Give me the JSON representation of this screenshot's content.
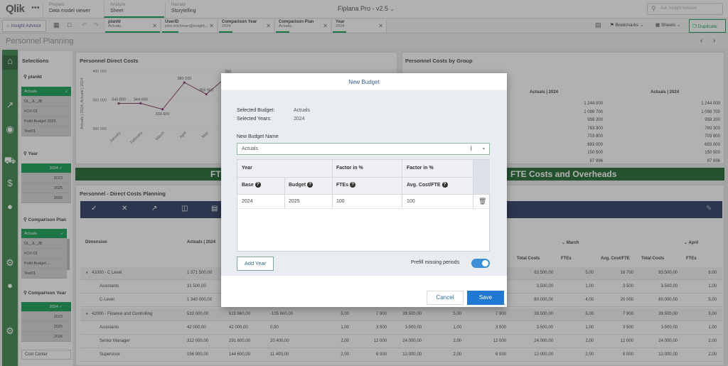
{
  "topbar": {
    "logo": "Qlik",
    "more_icon": "ellipsis-icon",
    "tabs": [
      {
        "sub": "Prepare",
        "main": "Data model viewer"
      },
      {
        "sub": "Analyze",
        "main": "Sheet"
      },
      {
        "sub": "Narrate",
        "main": "Storytelling"
      }
    ],
    "app_title": "Fiplana Pro - v2.5",
    "app_title_chevron": "⌄",
    "search_placeholder": "Ask Insight Advisor"
  },
  "toolbar": {
    "insight_advisor": "Insight Advisor",
    "chips": [
      {
        "name": "planId",
        "value": "Actuals"
      },
      {
        "name": "UserID",
        "value": "john.teichman@insight..."
      },
      {
        "name": "Comparison Year",
        "value": "2024"
      },
      {
        "name": "Comparison Plan",
        "value": "Actuals"
      },
      {
        "name": "Year",
        "value": "2024"
      }
    ],
    "bookmarks": "Bookmarks",
    "sheets": "Sheets",
    "duplicate": "Duplicate"
  },
  "sheet": {
    "title": "Personnel Planning"
  },
  "selections": {
    "title": "Selections",
    "planid": {
      "label": "planId",
      "items": [
        "Actuals",
        "DL_JL_JB",
        "FOV-01",
        "Politi Budget 2025",
        "Test01"
      ]
    },
    "year": {
      "label": "Year",
      "items": [
        "2024",
        "2023",
        "2025",
        "2026"
      ]
    },
    "compplan": {
      "label": "Comparison Plan",
      "items": [
        "Actuals",
        "DL_JL_JB",
        "FOV-01",
        "Politi Budget ...",
        "Test01"
      ]
    },
    "compyear": {
      "label": "Comparison Year",
      "items": [
        "2024",
        "2023",
        "2025",
        "2026"
      ]
    },
    "cost_center": "Cost Center"
  },
  "chart_data": {
    "type": "line",
    "title": "Personnel Direct Costs",
    "ylabel": "Actuals | 2024, Actuals | 2024",
    "ylim": [
      300000,
      400000
    ],
    "yticks": [
      "400 000",
      "350 000",
      "300 000"
    ],
    "categories": [
      "January",
      "February",
      "March",
      "April",
      "May",
      "June"
    ],
    "values": [
      343800,
      344000,
      333600,
      380100,
      359900,
      392000
    ],
    "labels": [
      "343 800",
      "344 000",
      "333 600",
      "380 100",
      "359 900",
      "392"
    ]
  },
  "group_panel": {
    "title": "Personnel Costs by Group",
    "col1": "Actuals | 2024",
    "col2": "Actuals | 2024",
    "values": [
      "1 244 000",
      "1 098 700",
      "959 200",
      "783 300",
      "703 800",
      "693 000",
      "150 500",
      "87 896"
    ]
  },
  "banner": {
    "left": "FT",
    "right": "FTE Costs and Overheads"
  },
  "planning": {
    "title": "Personnel - Direct Costs Planning",
    "dimension": "Dimension",
    "col_actuals": "Actuals | 2024",
    "march": "March",
    "april": "April",
    "heads": [
      "Total Costs",
      "FTEs",
      "Avg. Cost/FTE",
      "Total Costs",
      "FTEs"
    ],
    "rows": [
      {
        "name": "41000 - C Level",
        "actuals": "1 371 500,00",
        "c2": "",
        "c3": "",
        "c4": "",
        "c5": "",
        "c6": "",
        "c7": "",
        "r1": "83.500,00",
        "r2": "5,00",
        "r3": "16 700",
        "r4": "83.500,00",
        "r5": "6,00",
        "level": 0
      },
      {
        "name": "Assistants",
        "actuals": "31 500,00",
        "c2": "",
        "c3": "",
        "c4": "",
        "c5": "",
        "c6": "",
        "c7": "",
        "r1": "3.500,00",
        "r2": "1,00",
        "r3": "3 500",
        "r4": "3.500,00",
        "r5": "1,00",
        "level": 1
      },
      {
        "name": "C-Level",
        "actuals": "1 340 000,00",
        "c2": "",
        "c3": "",
        "c4": "",
        "c5": "",
        "c6": "",
        "c7": "",
        "r1": "80.000,00",
        "r2": "4,00",
        "r3": "20 000",
        "r4": "80.000,00",
        "r5": "5,00",
        "level": 1
      },
      {
        "name": "42000 - Finance and Controlling",
        "actuals": "510 000,00",
        "c2": "615 660,00",
        "c3": "-105 660,00",
        "c4": "5,00",
        "c5": "7 900",
        "c6": "39.500,00",
        "c7": "5,00",
        "c8": "7 900",
        "r1": "39.500,00",
        "r2": "5,00",
        "r3": "7 900",
        "r4": "39.500,00",
        "r5": "5,00",
        "level": 0
      },
      {
        "name": "Assistants",
        "actuals": "42 000,00",
        "c2": "42 000,00",
        "c3": "0,00",
        "c4": "1,00",
        "c5": "3 500",
        "c6": "3.500,00",
        "c7": "1,00",
        "c8": "3 500",
        "r1": "3.500,00",
        "r2": "1,00",
        "r3": "3 500",
        "r4": "3.500,00",
        "r5": "1,00",
        "level": 1
      },
      {
        "name": "Senior Manager",
        "actuals": "312 000,00",
        "c2": "291 600,00",
        "c3": "20 400,00",
        "c4": "2,00",
        "c5": "12 000",
        "c6": "24.000,00",
        "c7": "2,00",
        "c8": "12 000",
        "r1": "24.000,00",
        "r2": "2,00",
        "r3": "12 000",
        "r4": "24.000,00",
        "r5": "2,00",
        "level": 1
      },
      {
        "name": "Supervisor",
        "actuals": "156 000,00",
        "c2": "144 600,00",
        "c3": "11 400,00",
        "c4": "2,00",
        "c5": "6 000",
        "c6": "12.000,00",
        "c7": "2,00",
        "c8": "6 000",
        "r1": "12.000,00",
        "r2": "2,00",
        "r3": "6 000",
        "r4": "12.000,00",
        "r5": "2,00",
        "level": 1
      }
    ]
  },
  "modal": {
    "title": "New Budget",
    "selected_budget_label": "Selected Budget:",
    "selected_budget_value": "Actuals",
    "selected_years_label": "Selected Years:",
    "selected_years_value": "2024",
    "name_label": "New Budget Name",
    "name_value": "Actuals",
    "table": {
      "year": "Year",
      "factor1": "Factor in %",
      "factor2": "Factor in %",
      "base": "Base",
      "budget": "Budget",
      "ftes": "FTEs",
      "avg_cost": "Avg. Cost/FTE",
      "row": {
        "base": "2024",
        "budget": "2025",
        "ftes": "100",
        "avg_cost": "100"
      }
    },
    "add_year": "Add Year",
    "prefill": "Prefill missing periods",
    "cancel": "Cancel",
    "save": "Save"
  }
}
